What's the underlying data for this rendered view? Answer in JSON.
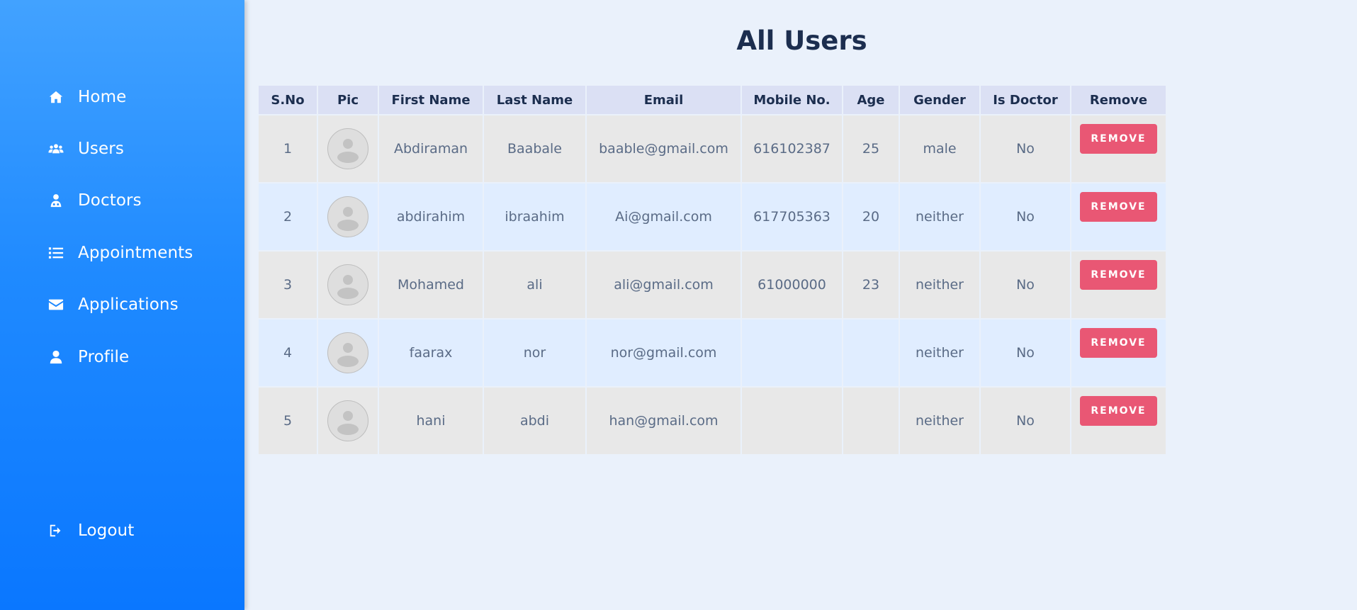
{
  "sidebar": {
    "items": [
      {
        "label": "Home",
        "icon": "home-icon"
      },
      {
        "label": "Users",
        "icon": "users-icon"
      },
      {
        "label": "Doctors",
        "icon": "doctor-icon"
      },
      {
        "label": "Appointments",
        "icon": "list-icon"
      },
      {
        "label": "Applications",
        "icon": "envelope-icon"
      },
      {
        "label": "Profile",
        "icon": "user-icon"
      }
    ],
    "logout": {
      "label": "Logout",
      "icon": "logout-icon"
    }
  },
  "main": {
    "title": "All Users",
    "table": {
      "headers": [
        "S.No",
        "Pic",
        "First Name",
        "Last Name",
        "Email",
        "Mobile No.",
        "Age",
        "Gender",
        "Is Doctor",
        "Remove"
      ],
      "remove_label": "REMOVE",
      "rows": [
        {
          "sno": "1",
          "first_name": "Abdiraman",
          "last_name": "Baabale",
          "email": "baable@gmail.com",
          "mobile": "616102387",
          "age": "25",
          "gender": "male",
          "is_doctor": "No"
        },
        {
          "sno": "2",
          "first_name": "abdirahim",
          "last_name": "ibraahim",
          "email": "Ai@gmail.com",
          "mobile": "617705363",
          "age": "20",
          "gender": "neither",
          "is_doctor": "No"
        },
        {
          "sno": "3",
          "first_name": "Mohamed",
          "last_name": "ali",
          "email": "ali@gmail.com",
          "mobile": "61000000",
          "age": "23",
          "gender": "neither",
          "is_doctor": "No"
        },
        {
          "sno": "4",
          "first_name": "faarax",
          "last_name": "nor",
          "email": "nor@gmail.com",
          "mobile": "",
          "age": "",
          "gender": "neither",
          "is_doctor": "No"
        },
        {
          "sno": "5",
          "first_name": "hani",
          "last_name": "abdi",
          "email": "han@gmail.com",
          "mobile": "",
          "age": "",
          "gender": "neither",
          "is_doctor": "No"
        }
      ]
    }
  },
  "colors": {
    "sidebar_top": "#42a2ff",
    "sidebar_bottom": "#0a77ff",
    "page_bg": "#eaf1fb",
    "header_bg": "#dbe0f4",
    "row_odd": "#e8e8e8",
    "row_even": "#e0edff",
    "remove_button": "#e95774",
    "title_text": "#1c2e4f"
  }
}
